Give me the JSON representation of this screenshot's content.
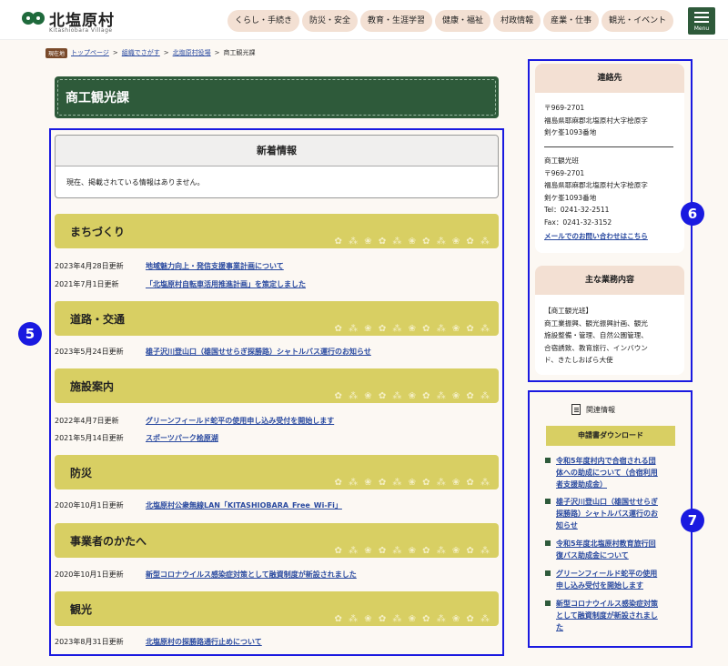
{
  "header": {
    "logo_title": "北塩原村",
    "logo_sub": "Kitashiobara Village",
    "nav": [
      "くらし・手続き",
      "防災・安全",
      "教育・生涯学習",
      "健康・福祉",
      "村政情報",
      "産業・仕事",
      "観光・イベント"
    ],
    "menu_label": "Menu"
  },
  "breadcrumb": {
    "badge": "現在地",
    "items": [
      "トップページ",
      "組織でさがす",
      "北塩原村役場"
    ],
    "sep": ">",
    "current": "商工観光課"
  },
  "page_title": "商工観光課",
  "news": {
    "title": "新着情報",
    "body": "現在、掲載されている情報はありません。"
  },
  "sections": [
    {
      "title": "まちづくり",
      "entries": [
        {
          "date": "2023年4月28日更新",
          "text": "地域魅力向上・発信支援事業計画について"
        },
        {
          "date": "2021年7月1日更新",
          "text": "「北塩原村自転車活用推進計画」を策定しました"
        }
      ]
    },
    {
      "title": "道路・交通",
      "entries": [
        {
          "date": "2023年5月24日更新",
          "text": "雄子沢川登山口（雄国せせらぎ探勝路）シャトルバス運行のお知らせ"
        }
      ]
    },
    {
      "title": "施設案内",
      "entries": [
        {
          "date": "2022年4月7日更新",
          "text": "グリーンフィールド蛇平の使用申し込み受付を開始します"
        },
        {
          "date": "2021年5月14日更新",
          "text": "スポーツパーク桧原湖"
        }
      ]
    },
    {
      "title": "防災",
      "entries": [
        {
          "date": "2020年10月1日更新",
          "text": "北塩原村公衆無線LAN「KITASHIOBARA_Free_Wi-Fi」"
        }
      ]
    },
    {
      "title": "事業者のかたへ",
      "entries": [
        {
          "date": "2020年10月1日更新",
          "text": "新型コロナウイルス感染症対策として融資制度が新設されました"
        }
      ]
    },
    {
      "title": "観光",
      "entries": [
        {
          "date": "2023年8月31日更新",
          "text": "北塩原村の探勝路通行止めについて"
        }
      ]
    }
  ],
  "contact": {
    "title": "連絡先",
    "address1": "〒969-2701\n福島県耶麻郡北塩原村大字桧原字\n剣ケ峯1093番地",
    "address2": "商工観光班\n〒969-2701\n福島県耶麻郡北塩原村大字桧原字\n剣ケ峯1093番地\nTel：0241-32-2511\nFax：0241-32-3152",
    "mail_link": "メールでのお問い合わせはこちら"
  },
  "duties": {
    "title": "主な業務内容",
    "text": "【商工観光班】\n商工業振興、観光振興計画、観光\n施設整備・管理、自然公園管理、\n合宿誘致、教育旅行、インバウン\nド、きたしおばら大使"
  },
  "related": {
    "title": "関連情報",
    "download": "申請書ダウンロード",
    "items": [
      "令和5年度村内で合宿される団\n体への助成について（合宿利用\n者支援助成金）",
      "雄子沢川登山口（雄国せせらぎ\n探勝路）シャトルバス運行のお\n知らせ",
      "令和5年度北塩原村教育旅行回\n復バス助成金について",
      "グリーンフィールド蛇平の使用\n申し込み受付を開始します",
      "新型コロナウイルス感染症対策\nとして融資制度が新設されまし\nた"
    ]
  },
  "annotations": [
    "5",
    "6",
    "7"
  ],
  "colors": {
    "accent_green": "#2e5a3a",
    "section_yellow": "#d8cf63",
    "nav_pill": "#f3e0d3",
    "link_blue": "#2a4aa0",
    "annotation_blue": "#1a1ae0"
  }
}
